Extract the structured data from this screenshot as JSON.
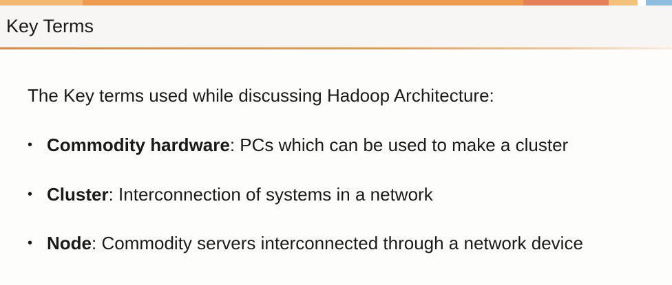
{
  "slide": {
    "title": "Key Terms",
    "intro": "The Key terms used while discussing Hadoop Architecture:",
    "bullet_char": "•",
    "terms": [
      {
        "name": "Commodity hardware",
        "separator": ":",
        "definition": " PCs which can be used to make a cluster"
      },
      {
        "name": "Cluster",
        "separator": ":",
        "definition": " Interconnection of systems in a network"
      },
      {
        "name": "Node",
        "separator": ":",
        "definition": " Commodity servers interconnected through a network device"
      }
    ]
  },
  "colors": {
    "accent_orange": "#ee9a4f",
    "accent_red": "#e4805a",
    "accent_blue": "#8fbde0",
    "title_rule": "#d98a3f"
  }
}
